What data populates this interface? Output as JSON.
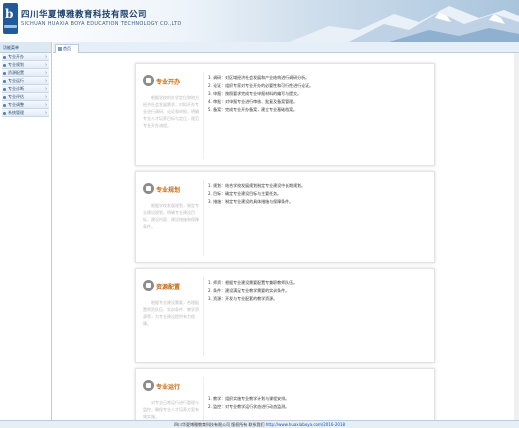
{
  "header": {
    "title_cn": "四川华夏博雅教育科技有限公司",
    "title_en": "SICHUAN HUAXIA BOYA EDUCATION TECHNOLOGY CO.,LTD",
    "logo_letter": "b"
  },
  "sidebar": {
    "title": "功能菜单",
    "items": [
      {
        "label": "专业开办"
      },
      {
        "label": "专业规划"
      },
      {
        "label": "资源配置"
      },
      {
        "label": "专业运行"
      },
      {
        "label": "专业诊断"
      },
      {
        "label": "专业评估"
      },
      {
        "label": "专业调整"
      },
      {
        "label": "系统管理"
      }
    ]
  },
  "tabs": [
    {
      "label": "首页"
    }
  ],
  "cards": [
    {
      "title": "专业开办",
      "desc": "根据学校的办学定位和地方经济社会发展需求，对拟开办专业进行调研、论证和申报，明确专业人才培养目标与定位，规范专业开办流程。",
      "lines": [
        "1. 调研：对区域经济社会发展和产业结构进行调研分析。",
        "2. 论证：组织专家对专业开办的必要性和可行性进行论证。",
        "3. 申报：按照要求完成专业申报材料的编写与提交。",
        "4. 审批：对申报专业进行审核、批复及备案管理。",
        "5. 备案：完成专业开办备案，建立专业基础档案。"
      ]
    },
    {
      "title": "专业规划",
      "desc": "根据学校发展规划，制定专业建设规划，明确专业建设目标、建设内容、建设措施和保障条件。",
      "lines": [
        "1. 规划：结合学校发展规划制定专业建设中长期规划。",
        "2. 目标：确定专业建设目标与主要任务。",
        "3. 措施：制定专业建设的具体措施与保障条件。"
      ]
    },
    {
      "title": "资源配置",
      "desc": "根据专业建设需要，合理配置师资队伍、实训条件、教学资源等，为专业建设提供有力保障。",
      "lines": [
        "1. 师资：根据专业建设需要配置专兼职教师队伍。",
        "2. 条件：建设满足专业教学需要的实训条件。",
        "3. 资源：开发与专业配套的教学资源。"
      ]
    },
    {
      "title": "专业运行",
      "desc": "对专业日常运行进行管理与监控，确保专业人才培养方案有效实施。",
      "lines": [
        "1. 教学：组织实施专业教学计划与课程安排。",
        "2. 监控：对专业教学运行状态进行动态监测。"
      ]
    }
  ],
  "footer": {
    "text": "四川华夏博雅教育科技有限公司 版权所有 联系我们",
    "link": "http://www.huaxiaboya.com/2016-2018"
  }
}
